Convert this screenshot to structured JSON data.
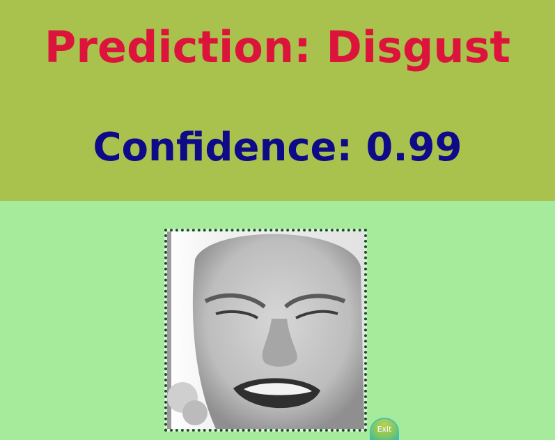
{
  "result": {
    "prediction_text": "Prediction: Disgust",
    "confidence_text": "Confidence: 0.99"
  },
  "image": {
    "subject": "grayscale face photo"
  },
  "controls": {
    "exit_label": "Exit"
  },
  "colors": {
    "header_background": "#a9c24d",
    "page_background": "#a6eb9c",
    "prediction_color": "#dc143c",
    "confidence_color": "#0e0a88",
    "frame_border": "#0b5a12"
  }
}
